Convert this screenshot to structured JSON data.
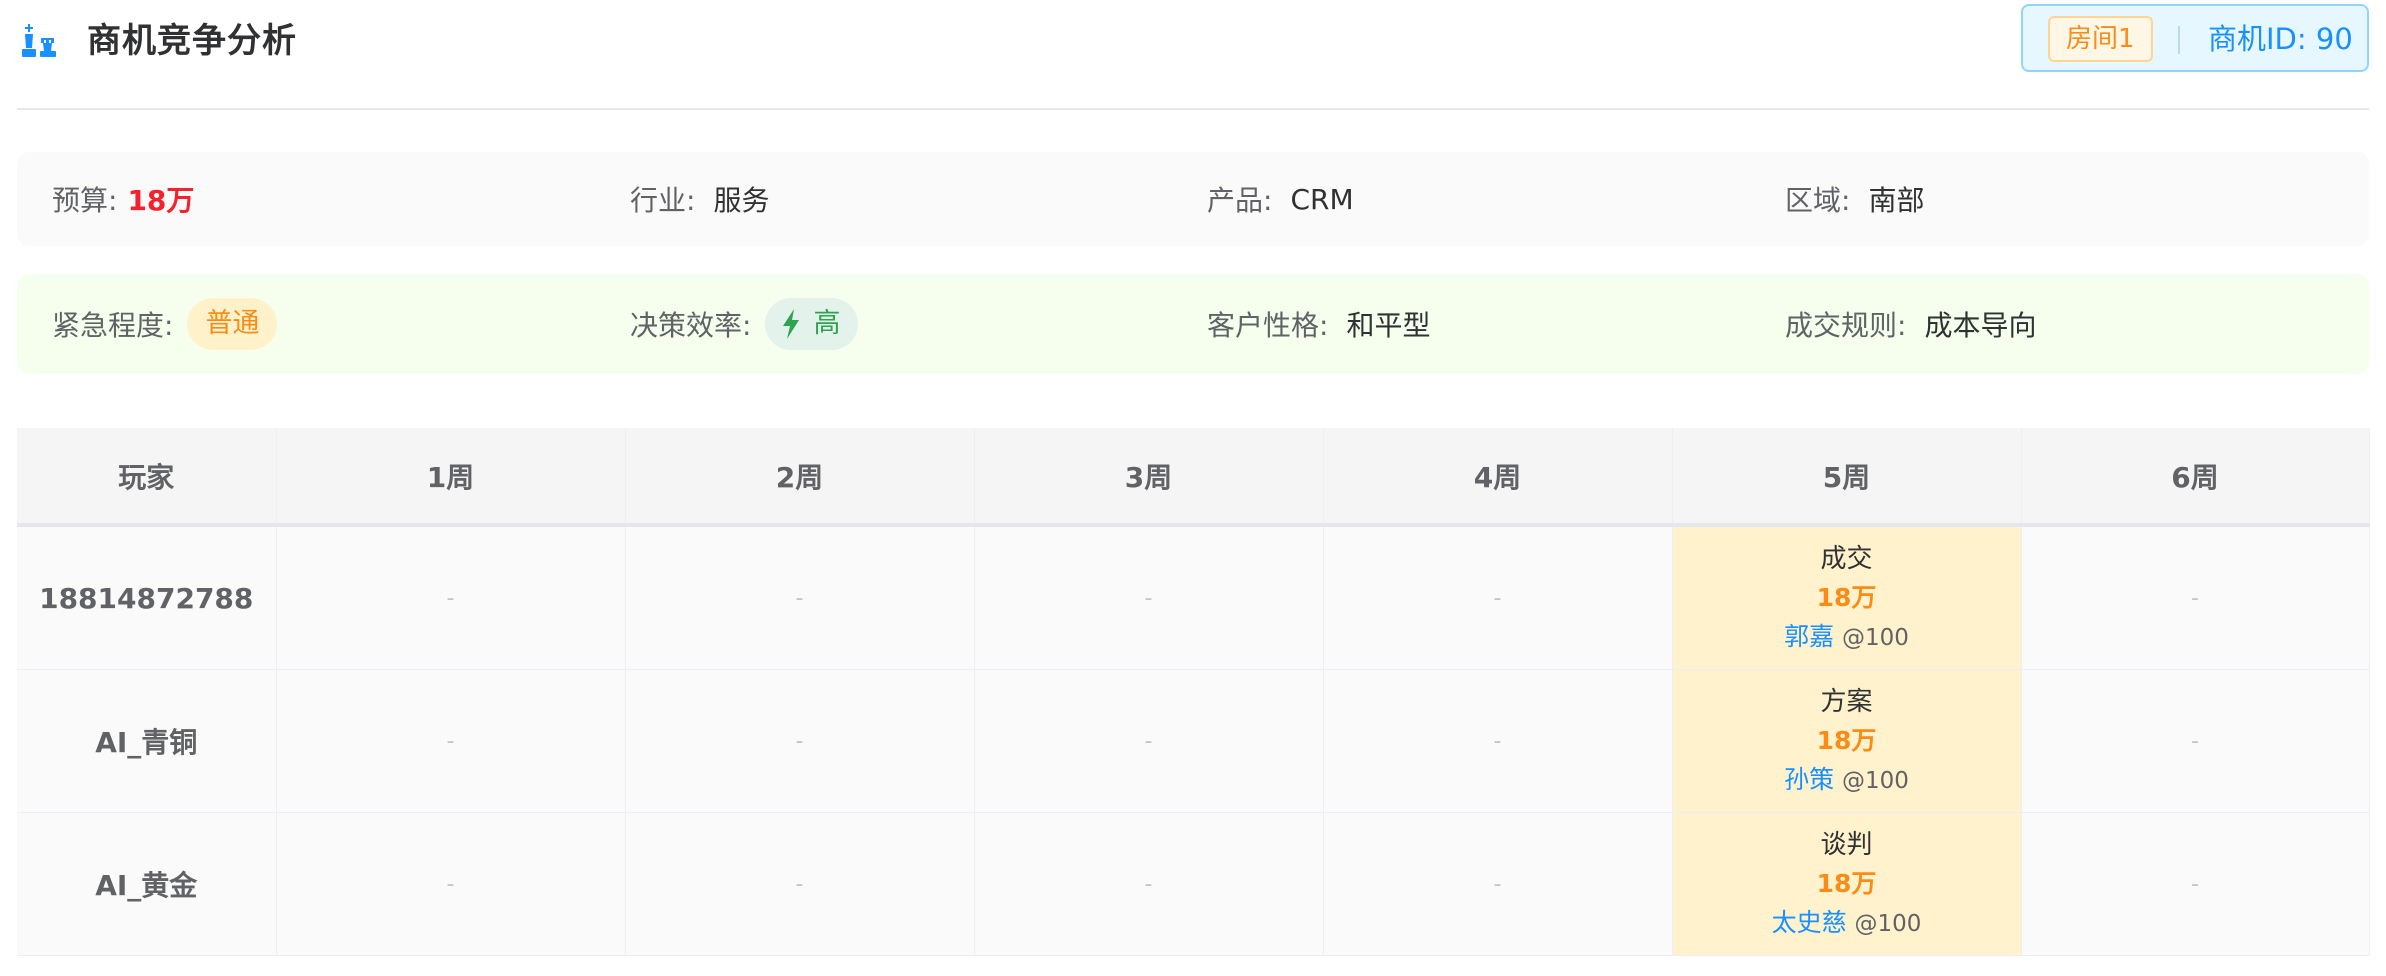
{
  "header": {
    "title": "商机竞争分析",
    "icon": "chess-icon",
    "room_tag": "房间1",
    "opportunity_id": "商机ID: 90"
  },
  "basic_info": {
    "budget": {
      "label": "预算:",
      "value": "18万"
    },
    "industry": {
      "label": "行业:",
      "value": "服务"
    },
    "product": {
      "label": "产品:",
      "value": "CRM"
    },
    "region": {
      "label": "区域:",
      "value": "南部"
    }
  },
  "traits": {
    "urgency": {
      "label": "紧急程度:",
      "value": "普通"
    },
    "decision_efficiency": {
      "label": "决策效率:",
      "value": "高",
      "icon": "bolt-icon"
    },
    "personality": {
      "label": "客户性格:",
      "value": "和平型"
    },
    "deal_rule": {
      "label": "成交规则:",
      "value": "成本导向"
    }
  },
  "table": {
    "headers": [
      "玩家",
      "1周",
      "2周",
      "3周",
      "4周",
      "5周",
      "6周"
    ],
    "empty_symbol": "-",
    "rows": [
      {
        "player": "18814872788",
        "week5": {
          "stage": "成交",
          "amount": "18万",
          "rep": "郭嘉",
          "score": "@100"
        }
      },
      {
        "player": "AI_青铜",
        "week5": {
          "stage": "方案",
          "amount": "18万",
          "rep": "孙策",
          "score": "@100"
        }
      },
      {
        "player": "AI_黄金",
        "week5": {
          "stage": "谈判",
          "amount": "18万",
          "rep": "太史慈",
          "score": "@100"
        }
      }
    ]
  },
  "colors": {
    "accent_blue": "#1890ff",
    "budget_red": "#f5222d",
    "amount_orange": "#fa8c16",
    "active_cell_bg": "#fff2cc",
    "traits_panel_bg": "#f6ffed",
    "efficiency_green": "#2ea44f"
  }
}
